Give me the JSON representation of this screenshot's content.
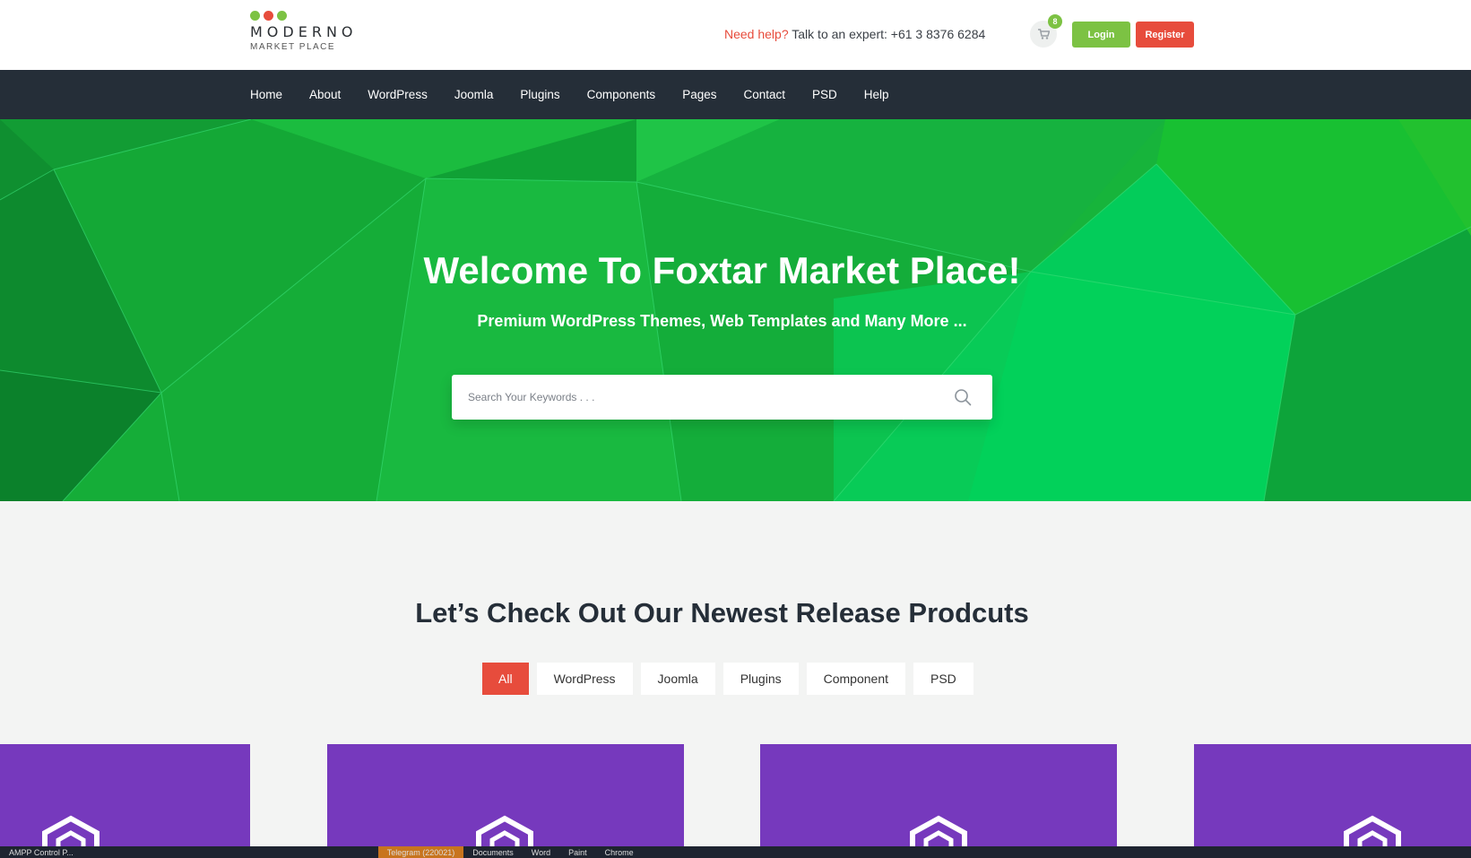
{
  "logo": {
    "name": "MODERNO",
    "sub": "MARKET PLACE",
    "dot_colors": [
      "#7cc243",
      "#e74c3c",
      "#7cc243"
    ]
  },
  "help": {
    "highlight": "Need help?",
    "text": "Talk to an expert: +61 3 8376 6284"
  },
  "cart": {
    "icon": "cart-icon",
    "count": "8"
  },
  "auth": {
    "login": "Login",
    "register": "Register"
  },
  "nav": [
    "Home",
    "About",
    "WordPress",
    "Joomla",
    "Plugins",
    "Components",
    "Pages",
    "Contact",
    "PSD",
    "Help"
  ],
  "hero": {
    "title": "Welcome To Foxtar Market Place!",
    "subtitle": "Premium WordPress Themes, Web Templates and Many More ...",
    "search_placeholder": "Search Your Keywords . . ."
  },
  "products": {
    "title": "Let’s Check Out Our Newest Release Prodcuts",
    "filters": [
      "All",
      "WordPress",
      "Joomla",
      "Plugins",
      "Component",
      "PSD"
    ],
    "active_filter": "All",
    "card_color": "#7639bd",
    "card_icon": "cube-logo-icon"
  },
  "taskbar": {
    "items": [
      "AMPP Control P...",
      "",
      "Telegram (220021)",
      "Documents",
      "Word",
      "Paint",
      "Chrome"
    ]
  },
  "colors": {
    "accent_green": "#7cc243",
    "accent_red": "#e74c3c",
    "nav_bg": "#252e38",
    "hero_green": "#15b43a"
  }
}
